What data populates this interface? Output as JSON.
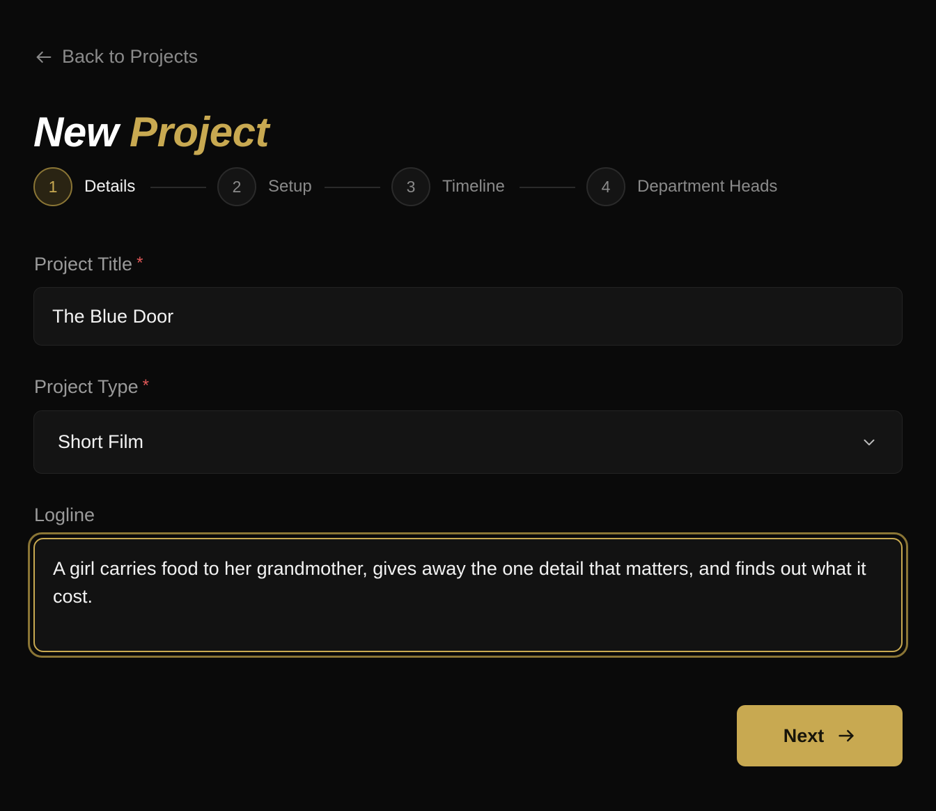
{
  "nav": {
    "back_label": "Back to Projects"
  },
  "header": {
    "title_part1": "New",
    "title_part2": "Project"
  },
  "stepper": {
    "steps": [
      {
        "number": "1",
        "label": "Details",
        "state": "active"
      },
      {
        "number": "2",
        "label": "Setup",
        "state": "inactive"
      },
      {
        "number": "3",
        "label": "Timeline",
        "state": "inactive"
      },
      {
        "number": "4",
        "label": "Department Heads",
        "state": "inactive"
      }
    ]
  },
  "form": {
    "project_title": {
      "label": "Project Title",
      "required_mark": "*",
      "value": "The Blue Door"
    },
    "project_type": {
      "label": "Project Type",
      "required_mark": "*",
      "selected": "Short Film"
    },
    "logline": {
      "label": "Logline",
      "value": "A girl carries food to her grandmother, gives away the one detail that matters, and finds out what it cost."
    }
  },
  "actions": {
    "next_label": "Next"
  },
  "theme": {
    "accent": "#c8a951",
    "background": "#0a0a0a",
    "required": "#e05858"
  }
}
